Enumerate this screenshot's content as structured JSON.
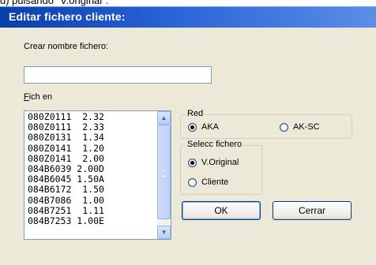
{
  "caption": "d) pulsando \"V.original\":",
  "dialog": {
    "title": "Editar fichero cliente:",
    "create_label": "Crear nombre fichero:",
    "filename_value": "",
    "list_label": "Fich en",
    "list_items": [
      "080Z0111  2.32",
      "080Z0111  2.33",
      "080Z0131  1.34",
      "080Z0141  1.20",
      "080Z0141  2.00",
      "084B6039 2.00D",
      "084B6045 1.50A",
      "084B6172  1.50",
      "084B7086  1.00",
      "084B7251  1.11",
      "084B7253 1.00E"
    ],
    "red_group": {
      "legend": "Red",
      "options": [
        "AKA",
        "AK-SC"
      ],
      "selected": "AKA"
    },
    "select_group": {
      "legend": "Selecc fichero",
      "options": [
        "V.Original",
        "Cliente"
      ],
      "selected": "V.Original"
    },
    "ok_label": "OK",
    "close_label": "Cerrar"
  },
  "icons": {
    "scroll_up": "chevron-up-icon",
    "scroll_down": "chevron-down-icon"
  }
}
